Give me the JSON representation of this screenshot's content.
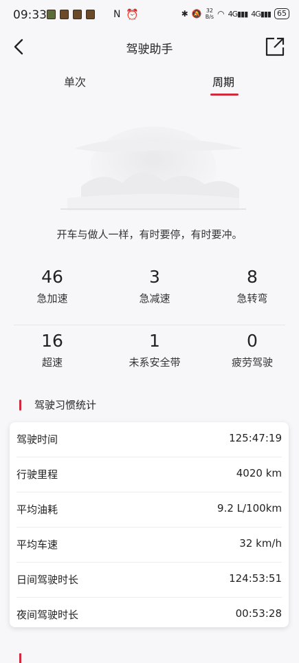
{
  "status": {
    "time": "09:33",
    "speed_top": "32",
    "speed_unit": "B/s",
    "network1": "4G",
    "network2": "4G",
    "battery": "65"
  },
  "nav": {
    "title": "驾驶助手"
  },
  "tabs": [
    {
      "label": "单次",
      "active": false
    },
    {
      "label": "周期",
      "active": true
    }
  ],
  "quote": "开车与做人一样，有时要停，有时要冲。",
  "stats": [
    {
      "value": "46",
      "label": "急加速"
    },
    {
      "value": "3",
      "label": "急减速"
    },
    {
      "value": "8",
      "label": "急转弯"
    },
    {
      "value": "16",
      "label": "超速"
    },
    {
      "value": "1",
      "label": "未系安全带"
    },
    {
      "value": "0",
      "label": "疲劳驾驶"
    }
  ],
  "section": {
    "title": "驾驶习惯统计"
  },
  "habits": [
    {
      "key": "驾驶时间",
      "value": "125:47:19"
    },
    {
      "key": "行驶里程",
      "value": "4020 km"
    },
    {
      "key": "平均油耗",
      "value": "9.2 L/100km"
    },
    {
      "key": "平均车速",
      "value": "32 km/h"
    },
    {
      "key": "日间驾驶时长",
      "value": "124:53:51"
    },
    {
      "key": "夜间驾驶时长",
      "value": "00:53:28"
    }
  ],
  "colors": {
    "accent": "#cf2b3c",
    "background": "#f7f7f9"
  }
}
